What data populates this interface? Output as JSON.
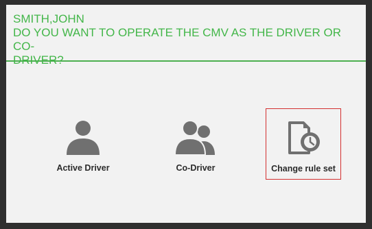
{
  "header": {
    "driver_name": "SMITH,JOHN",
    "question_line1": "DO YOU WANT TO OPERATE THE CMV AS THE DRIVER OR CO-",
    "question_line2": "DRIVER?"
  },
  "actions": [
    {
      "label": "Active Driver",
      "icon": "person-icon"
    },
    {
      "label": "Co-Driver",
      "icon": "two-persons-icon"
    },
    {
      "label": "Change rule set",
      "icon": "document-clock-icon",
      "selected": true
    }
  ],
  "colors": {
    "accent_green": "#43b649",
    "selection_red": "#d32f2f",
    "icon_gray": "#707070"
  }
}
